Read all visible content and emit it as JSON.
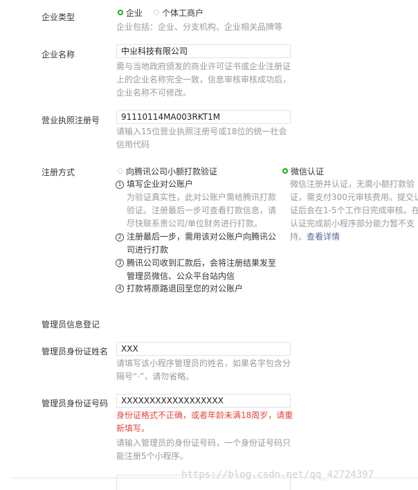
{
  "company_type": {
    "label": "企业类型",
    "option_selected": "企业",
    "option_other": "个体工商户",
    "hint": "企业包括：企业、分支机构、企业相关品牌等"
  },
  "company_name": {
    "label": "企业名称",
    "value": "中ㄓ科技有限公司",
    "hint_lines": [
      "需与当地政府颁发的商业许可证书或企业注册证",
      "上的企业名称完全一致，信息审核审核成功后，",
      "企业名称不可修改。"
    ]
  },
  "license": {
    "label": "营业执照注册号",
    "value": "91110114MA003RKT1M",
    "hint_lines": [
      "请输入15位营业执照注册号或18位的统一社会",
      "信用代码"
    ]
  },
  "register_method": {
    "label": "注册方式",
    "option_bank": "向腾讯公司小额打款验证",
    "option_wechat": "微信认证",
    "steps": [
      {
        "num": "1",
        "title": "填写企业对公账户",
        "desc": [
          "为验证真实性，此对公账户需给腾讯打款",
          "验证。注册最后一步可查看打款信息，请",
          "尽快联系贵公司/单位财务进行打款。"
        ]
      },
      {
        "num": "2",
        "title_lines": [
          "注册最后一步，需用该对公账户向腾讯公",
          "司进行打款"
        ]
      },
      {
        "num": "3",
        "title_lines": [
          "腾讯公司收到汇款后，会将注册结果发至",
          "管理员微信、公众平台站内信"
        ]
      },
      {
        "num": "4",
        "title_lines": [
          "打款将原路退回至您的对公账户"
        ]
      }
    ],
    "wechat_desc": [
      "微信注册并认证，无需小额打款验",
      "证，需支付300元审核费用。提交认",
      "证后会在1-5个工作日完成审核。在",
      "认证完成前小程序部分能力暂不支"
    ],
    "wechat_desc_tail": "持。",
    "wechat_link": "查看详情"
  },
  "admin_section": {
    "title": "管理员信息登记"
  },
  "admin_name": {
    "label": "管理员身份证姓名",
    "value": "XXX",
    "hint_lines": [
      "请填写该小程序管理员的姓名，如果名字包含分",
      "隔号“·”，请勿省略。"
    ]
  },
  "admin_id": {
    "label": "管理员身份证号码",
    "value": "XXXXXXXXXXXXXXXXXX",
    "error_lines": [
      "身份证格式不正确，或者年龄未满18周岁，请重",
      "新填写。"
    ],
    "hint_lines": [
      "请输入管理员的身份证号码，一个身份证号码只",
      "能注册5个小程序。"
    ]
  },
  "watermark": "https://blog.csdn.net/qq_42724397"
}
